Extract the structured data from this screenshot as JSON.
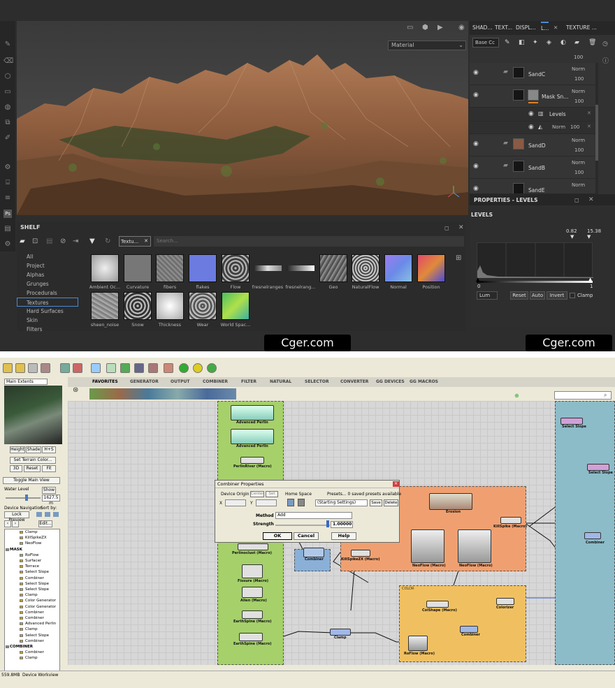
{
  "viewport": {
    "material_select": "Material"
  },
  "layers_panel": {
    "tabs": [
      "SHAD...",
      "TEXT...",
      "DISPL...",
      "L...",
      "TEXTURE ..."
    ],
    "channel_select": "Base Cc",
    "top_opacity": "100",
    "rows": [
      {
        "name": "SandC",
        "blend": "Norm",
        "opacity": "100"
      },
      {
        "name": "Mask Sn...",
        "blend": "Norm",
        "opacity": "100"
      },
      {
        "name": "SandD",
        "blend": "Norm",
        "opacity": "100"
      },
      {
        "name": "SandB",
        "blend": "Norm",
        "opacity": "100"
      },
      {
        "name": "SandE",
        "blend": "Norm",
        "opacity": ""
      }
    ],
    "effects": [
      {
        "name": "Levels"
      },
      {
        "name": "",
        "blend": "Norm",
        "opacity": "100"
      }
    ]
  },
  "properties": {
    "title": "PROPERTIES - LEVELS",
    "section": "LEVELS",
    "in_values": [
      "0.82",
      "15.38"
    ],
    "scale_min": "0",
    "scale_max": "1",
    "channel": "Lum",
    "buttons": [
      "Reset",
      "Auto",
      "Invert"
    ],
    "clamp_label": "Clamp"
  },
  "shelf": {
    "title": "SHELF",
    "filter_chip": "Textu...",
    "search_placeholder": "Search...",
    "categories": [
      "All",
      "Project",
      "Alphas",
      "Grunges",
      "Procedurals",
      "Textures",
      "Hard Surfaces",
      "Skin",
      "Filters"
    ],
    "selected_category": "Textures",
    "items_row1": [
      "Ambient Oc...",
      "Curvature",
      "fibers",
      "flakes",
      "Flow",
      "fresnelranges",
      "fresnelrang...",
      "Geo",
      "NaturalFlow",
      "Normal",
      "Position"
    ],
    "items_row2": [
      "sheen_noise",
      "Snow",
      "Thickness",
      "Wear",
      "World Spac..."
    ]
  },
  "watermarks": [
    "Cger.com",
    "Cger.com"
  ],
  "geo": {
    "left": {
      "extents": "Main Extents",
      "view_buttons": [
        "Height",
        "Shade",
        "H+S"
      ],
      "set_color": "Set Terrain Color...",
      "mode_buttons": [
        "3D",
        "Reset",
        "Fit"
      ],
      "toggle_main": "Toggle Main View",
      "water_level": "Water Level",
      "show": "Show",
      "water_value": "1627.5 m",
      "device_nav": "Device Navigation",
      "sort_by": "Sort by:",
      "lock_preview": "Lock Preview",
      "edit": "Edit...",
      "tree": [
        "Clamp",
        "KillSpikeZX",
        "NeoFlow",
        "MASK",
        "RoFlow",
        "Surfacer",
        "Terrace",
        "Select Slope",
        "Combiner",
        "Select Slope",
        "Select Slope",
        "Clamp",
        "Color Generator",
        "Color Generator",
        "Combiner",
        "Combiner",
        "Advanced Perlin",
        "Clamp",
        "Select Slope",
        "Combiner",
        "COMBINER",
        "Combiner",
        "Clamp"
      ]
    },
    "tabs": [
      "FAVORITES",
      "GENERATOR",
      "OUTPUT",
      "COMBINER",
      "FILTER",
      "NATURAL",
      "SELECTOR",
      "CONVERTER",
      "GG DEVICES",
      "GG MACROS"
    ],
    "nodes": [
      "Advanced Perlin",
      "Advanced Perlin",
      "PerlinRiver (Macro)",
      "Perlinoclust (Macro)",
      "Fissure (Macro)",
      "Alien (Macro)",
      "EarthSpine (Macro)",
      "EarthSpine (Macro)",
      "Combiner",
      "KillSpikeZX (Macro)",
      "Erosion",
      "NeoFlow (Macro)",
      "NeoFlow (Macro)",
      "KillSpike (Macro)",
      "Select Slope",
      "Select Slope",
      "Combiner",
      "Clamp",
      "Colorizer",
      "ColShape (Macro)",
      "Combiner",
      "RoFlow (Macro)"
    ],
    "group_label": "COLOR",
    "dialog": {
      "title": "Combiner Properties",
      "device_origin": "Device Origin",
      "center": "Center",
      "set": "Set",
      "home_space": "Home Space",
      "presets": "Presets... 0 saved presets available",
      "x_label": "X",
      "y_label": "Y",
      "preset_value": "(Starting Settings)",
      "save": "Save",
      "delete": "Delete",
      "method_label": "Method",
      "method_value": "Add",
      "strength_label": "Strength",
      "strength_value": "1.00000",
      "ok": "OK",
      "cancel": "Cancel",
      "help": "Help"
    },
    "status": {
      "memory": "559.8MB",
      "mode": "Device Workview"
    }
  }
}
